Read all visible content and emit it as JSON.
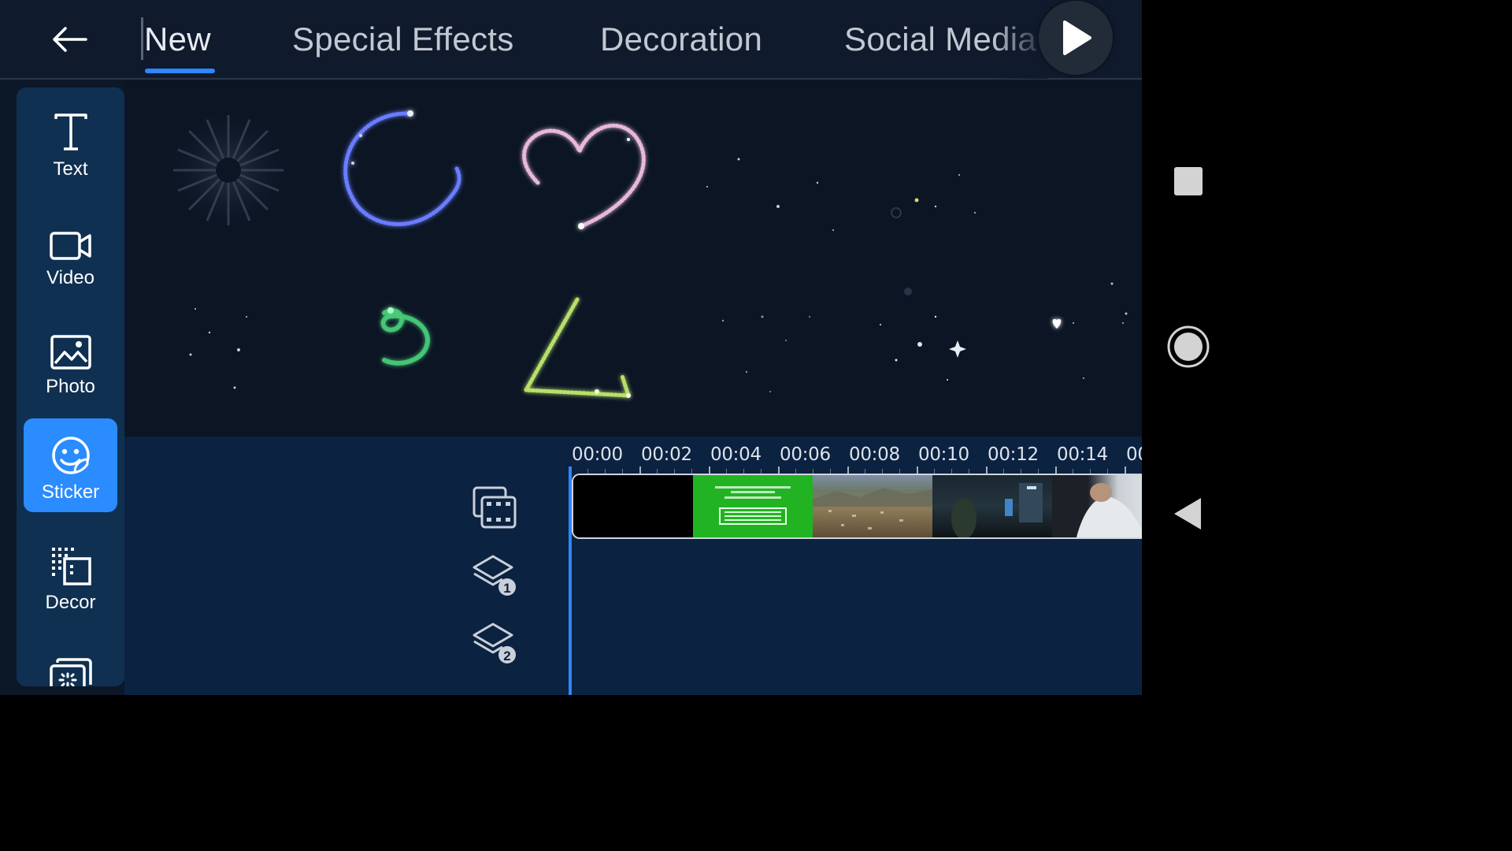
{
  "header": {
    "tabs": [
      {
        "label": "New",
        "active": true
      },
      {
        "label": "Special Effects",
        "active": false
      },
      {
        "label": "Decoration",
        "active": false
      },
      {
        "label": "Social Media",
        "active": false
      }
    ]
  },
  "toolbar": {
    "items": [
      {
        "label": "Text",
        "icon": "text-icon",
        "active": false
      },
      {
        "label": "Video",
        "icon": "video-camera-icon",
        "active": false
      },
      {
        "label": "Photo",
        "icon": "photo-icon",
        "active": false
      },
      {
        "label": "Sticker",
        "icon": "sticker-icon",
        "active": true
      },
      {
        "label": "Decor",
        "icon": "decor-icon",
        "active": false
      },
      {
        "label": "",
        "icon": "effects-icon",
        "active": false
      }
    ]
  },
  "timeline": {
    "ruler": [
      "00:00",
      "00:02",
      "00:04",
      "00:06",
      "00:08",
      "00:10",
      "00:12",
      "00:14",
      "00"
    ],
    "track_icons": [
      {
        "icon": "video-track-icon"
      },
      {
        "icon": "layer-1-icon",
        "badge": "1"
      },
      {
        "icon": "layer-2-icon",
        "badge": "2"
      }
    ],
    "playhead_time": "00:00"
  },
  "colors": {
    "accent": "#2a8cff",
    "background": "#0c1728",
    "rail": "#103052",
    "timeline": "#0b2240"
  }
}
